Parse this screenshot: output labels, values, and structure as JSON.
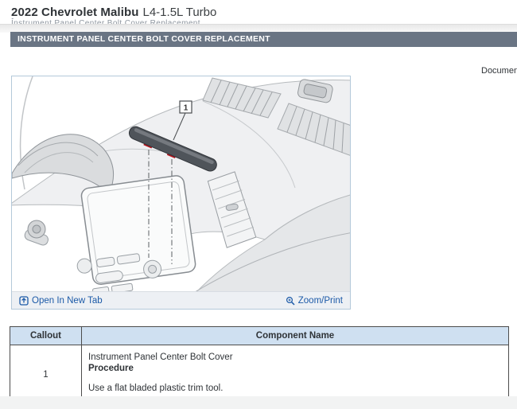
{
  "titlebar": {
    "vehicle": "2022 Chevrolet Malibu",
    "engine": "L4-1.5L Turbo",
    "clipped_prefix": "•",
    "clipped_item": "Instrument Panel Center Bolt Cover Replacement"
  },
  "section_header": {
    "title": "INSTRUMENT PANEL CENTER BOLT COVER REPLACEMENT"
  },
  "meta": {
    "document_label": "Document"
  },
  "figure": {
    "callout_label": "1",
    "open_in_new_tab": "Open In New Tab",
    "zoom_print": "Zoom/Print"
  },
  "table": {
    "headers": [
      "Callout",
      "Component Name"
    ],
    "rows": [
      {
        "callout": "1",
        "component_name": "Instrument Panel Center Bolt Cover",
        "procedure_label": "Procedure",
        "procedure_note": "Use a flat bladed plastic trim tool."
      }
    ]
  },
  "colors": {
    "section_bar_bg": "#6a7584",
    "table_header_bg": "#cfe0f1",
    "link_blue": "#1c5aa8",
    "callout_red": "#b5121b",
    "figure_border": "#b4c9da",
    "part_dark": "#4f545a"
  }
}
